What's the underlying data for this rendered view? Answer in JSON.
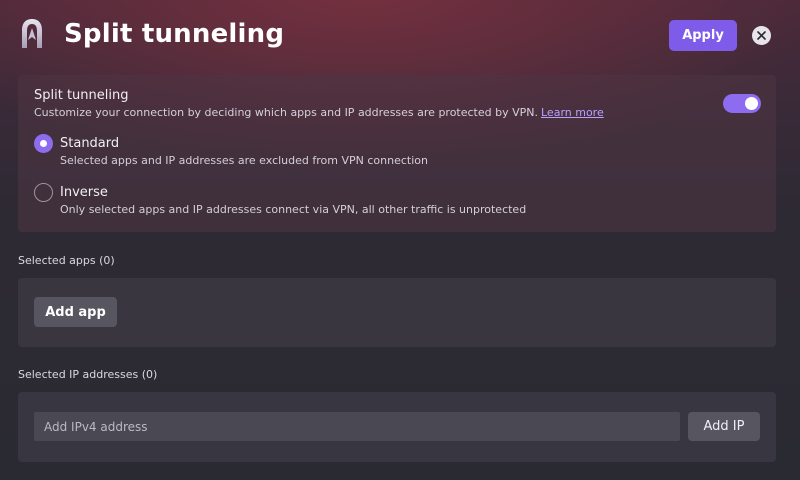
{
  "header": {
    "title": "Split tunneling",
    "apply_label": "Apply",
    "logo_icon": "vpn-logo-icon",
    "close_icon": "close-icon"
  },
  "split_tunneling": {
    "title": "Split tunneling",
    "description": "Customize your connection by deciding which apps and IP addresses are protected by VPN.",
    "learn_more": "Learn more",
    "enabled": true,
    "options": [
      {
        "title": "Standard",
        "description": "Selected apps and IP addresses are excluded from VPN connection",
        "selected": true
      },
      {
        "title": "Inverse",
        "description": "Only selected apps and IP addresses connect via VPN, all other traffic is unprotected",
        "selected": false
      }
    ]
  },
  "apps": {
    "label": "Selected apps (0)",
    "add_label": "Add app"
  },
  "ip": {
    "label": "Selected IP addresses (0)",
    "placeholder": "Add IPv4 address",
    "add_label": "Add IP"
  },
  "colors": {
    "accent": "#7e5ce9",
    "toggle_on": "#8e6cf0"
  }
}
